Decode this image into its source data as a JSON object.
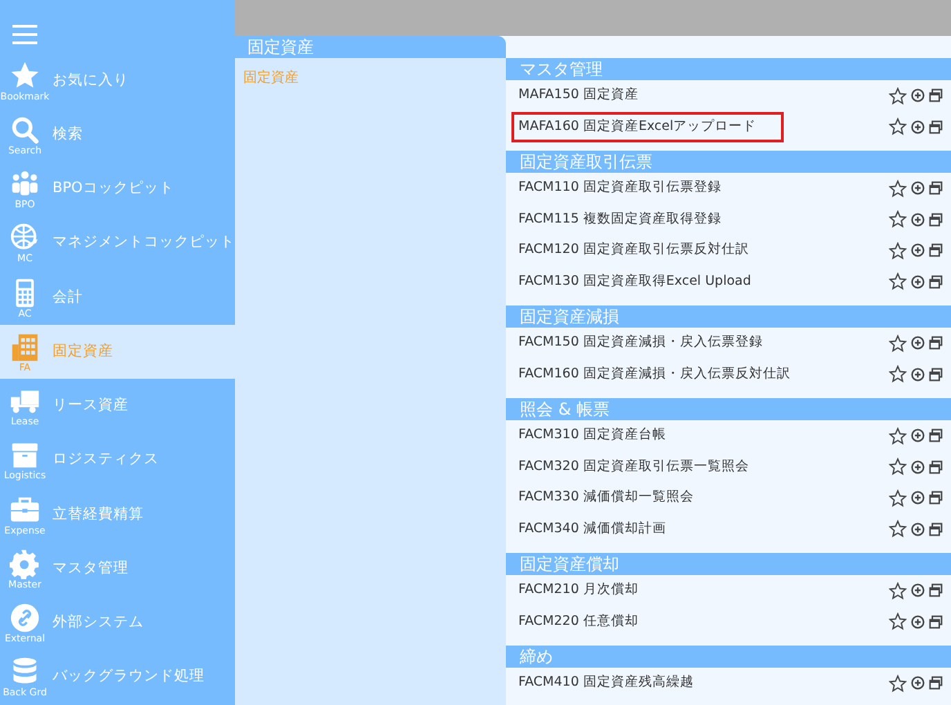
{
  "sidebar": {
    "items": [
      {
        "label": "お気に入り",
        "caption": "Bookmark",
        "selected": false
      },
      {
        "label": "検索",
        "caption": "Search",
        "selected": false
      },
      {
        "label": "BPOコックピット",
        "caption": "BPO",
        "selected": false
      },
      {
        "label": "マネジメントコックピット",
        "caption": "MC",
        "selected": false
      },
      {
        "label": "会計",
        "caption": "AC",
        "selected": false
      },
      {
        "label": "固定資産",
        "caption": "FA",
        "selected": true
      },
      {
        "label": "リース資産",
        "caption": "Lease",
        "selected": false
      },
      {
        "label": "ロジスティクス",
        "caption": "Logistics",
        "selected": false
      },
      {
        "label": "立替経費精算",
        "caption": "Expense",
        "selected": false
      },
      {
        "label": "マスタ管理",
        "caption": "Master",
        "selected": false
      },
      {
        "label": "外部システム",
        "caption": "External",
        "selected": false
      },
      {
        "label": "バックグラウンド処理",
        "caption": "Back Grd",
        "selected": false
      }
    ]
  },
  "category_panel": {
    "title": "固定資産",
    "items": [
      {
        "label": "固定資産"
      }
    ]
  },
  "sections": [
    {
      "title": "マスタ管理",
      "rows": [
        {
          "label": "MAFA150 固定資産",
          "highlighted": false
        },
        {
          "label": "MAFA160 固定資産Excelアップロード",
          "highlighted": true
        }
      ]
    },
    {
      "title": "固定資産取引伝票",
      "rows": [
        {
          "label": "FACM110 固定資産取引伝票登録",
          "highlighted": false
        },
        {
          "label": "FACM115 複数固定資産取得登録",
          "highlighted": false
        },
        {
          "label": "FACM120 固定資産取引伝票反対仕訳",
          "highlighted": false
        },
        {
          "label": "FACM130 固定資産取得Excel Upload",
          "highlighted": false
        }
      ]
    },
    {
      "title": "固定資産減損",
      "rows": [
        {
          "label": "FACM150 固定資産減損・戻入伝票登録",
          "highlighted": false
        },
        {
          "label": "FACM160 固定資産減損・戻入伝票反対仕訳",
          "highlighted": false
        }
      ]
    },
    {
      "title": "照会 & 帳票",
      "rows": [
        {
          "label": "FACM310 固定資産台帳",
          "highlighted": false
        },
        {
          "label": "FACM320 固定資産取引伝票一覧照会",
          "highlighted": false
        },
        {
          "label": "FACM330 減価償却一覧照会",
          "highlighted": false
        },
        {
          "label": "FACM340 減価償却計画",
          "highlighted": false
        }
      ]
    },
    {
      "title": "固定資産償却",
      "rows": [
        {
          "label": "FACM210 月次償却",
          "highlighted": false
        },
        {
          "label": "FACM220 任意償却",
          "highlighted": false
        }
      ]
    },
    {
      "title": "締め",
      "rows": [
        {
          "label": "FACM410 固定資産残高繰越",
          "highlighted": false
        }
      ]
    }
  ]
}
